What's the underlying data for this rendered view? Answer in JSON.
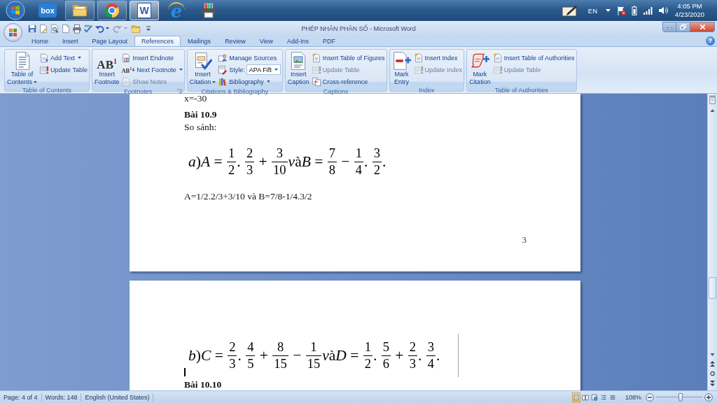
{
  "taskbar": {
    "apps": [
      {
        "kind": "box",
        "text": "box",
        "running": false,
        "selected": false
      },
      {
        "kind": "folder",
        "running": true,
        "selected": false
      },
      {
        "kind": "chrome",
        "running": true,
        "selected": false
      },
      {
        "kind": "word",
        "text": "W",
        "running": true,
        "selected": true
      },
      {
        "kind": "ie",
        "text": "e",
        "running": false,
        "selected": false
      },
      {
        "kind": "printer",
        "running": false,
        "selected": false
      }
    ],
    "tray": {
      "language": "EN",
      "time": "4:05 PM",
      "date": "4/23/2020"
    }
  },
  "window": {
    "title": "PHÉP NHÂN PHÂN SỐ - Microsoft Word",
    "help": "?"
  },
  "quick_access": [
    {
      "kind": "save",
      "dropdown": false,
      "disabled": false
    },
    {
      "kind": "edit",
      "dropdown": false,
      "disabled": false
    },
    {
      "kind": "preview",
      "dropdown": false,
      "disabled": false
    },
    {
      "kind": "new",
      "dropdown": false,
      "disabled": false
    },
    {
      "kind": "print",
      "dropdown": false,
      "disabled": false
    },
    {
      "kind": "spelling",
      "dropdown": false,
      "disabled": false
    },
    {
      "kind": "undo",
      "dropdown": true,
      "disabled": false
    },
    {
      "kind": "redo",
      "dropdown": true,
      "disabled": true
    },
    {
      "kind": "open",
      "dropdown": false,
      "disabled": false
    },
    {
      "kind": "customize",
      "dropdown": false,
      "disabled": false
    }
  ],
  "tabs": [
    {
      "label": "Home",
      "selected": false
    },
    {
      "label": "Insert",
      "selected": false
    },
    {
      "label": "Page Layout",
      "selected": false
    },
    {
      "label": "References",
      "selected": true
    },
    {
      "label": "Mailings",
      "selected": false
    },
    {
      "label": "Review",
      "selected": false
    },
    {
      "label": "View",
      "selected": false
    },
    {
      "label": "Add-Ins",
      "selected": false
    },
    {
      "label": "PDF",
      "selected": false
    }
  ],
  "ribbon": {
    "groups": [
      {
        "label": "Table of Contents",
        "launcher": false,
        "large": {
          "kind": "toc",
          "lines": [
            "Table of",
            "Contents"
          ],
          "dropdown": true
        },
        "small": [
          {
            "kind": "addtext",
            "label": "Add Text",
            "dropdown": true,
            "disabled": false
          },
          {
            "kind": "update",
            "label": "Update Table",
            "dropdown": false,
            "disabled": false
          }
        ]
      },
      {
        "label": "Footnotes",
        "launcher": true,
        "large": {
          "kind": "footnote",
          "glyph": "AB$^{1}$",
          "lines": [
            "Insert",
            "Footnote"
          ],
          "dropdown": false
        },
        "small": [
          {
            "kind": "endnote",
            "label": "Insert Endnote",
            "dropdown": false,
            "disabled": false
          },
          {
            "kind": "nextfootnote",
            "glyph": "AB$^{1}$",
            "label": "Next Footnote",
            "dropdown": true,
            "disabled": false
          },
          {
            "kind": "notes",
            "label": "Show Notes",
            "dropdown": false,
            "disabled": true
          }
        ]
      },
      {
        "label": "Citations & Bibliography",
        "launcher": false,
        "large": {
          "kind": "citation",
          "lines": [
            "Insert",
            "Citation"
          ],
          "dropdown": true
        },
        "small": [
          {
            "kind": "sources",
            "label": "Manage Sources",
            "dropdown": false,
            "disabled": false
          },
          {
            "kind": "combo",
            "label": "Style:",
            "value": "APA Fift",
            "dropdown": true,
            "disabled": false
          },
          {
            "kind": "bibliography",
            "label": "Bibliography",
            "dropdown": true,
            "disabled": false
          }
        ]
      },
      {
        "label": "Captions",
        "launcher": false,
        "large": {
          "kind": "caption",
          "lines": [
            "Insert",
            "Caption"
          ],
          "dropdown": false
        },
        "small": [
          {
            "kind": "figures",
            "label": "Insert Table of Figures",
            "dropdown": false,
            "disabled": false
          },
          {
            "kind": "update",
            "label": "Update Table",
            "dropdown": false,
            "disabled": true
          },
          {
            "kind": "crossref",
            "label": "Cross-reference",
            "dropdown": false,
            "disabled": false
          }
        ]
      },
      {
        "label": "Index",
        "launcher": false,
        "large": {
          "kind": "markentry",
          "lines": [
            "Mark",
            "Entry"
          ],
          "dropdown": false
        },
        "small": [
          {
            "kind": "index",
            "label": "Insert Index",
            "dropdown": false,
            "disabled": false
          },
          {
            "kind": "update",
            "label": "Update Index",
            "dropdown": false,
            "disabled": true
          }
        ]
      },
      {
        "label": "Table of Authorities",
        "launcher": false,
        "large": {
          "kind": "markcitation",
          "lines": [
            "Mark",
            "Citation"
          ],
          "dropdown": false
        },
        "small": [
          {
            "kind": "index",
            "label": "Insert Table of Authorities",
            "dropdown": false,
            "disabled": false
          },
          {
            "kind": "update",
            "label": "Update Table",
            "dropdown": false,
            "disabled": true
          }
        ]
      }
    ]
  },
  "document": {
    "pages": [
      {
        "blocks": [
          {
            "kind": "para",
            "text": "x=-30"
          },
          {
            "kind": "heading",
            "text": "Bài 10.9"
          },
          {
            "kind": "para",
            "text": "So sánh:"
          },
          {
            "kind": "math",
            "boundary_line": false,
            "tokens": [
              {
                "kind": "var",
                "text": "a"
              },
              {
                "kind": "text",
                "text": ")"
              },
              {
                "kind": "var",
                "text": "A"
              },
              {
                "kind": "text",
                "text": " = "
              },
              {
                "kind": "frac",
                "num": "1",
                "den": "2"
              },
              {
                "kind": "text",
                "text": ". "
              },
              {
                "kind": "frac",
                "num": "2",
                "den": "3"
              },
              {
                "kind": "text",
                "text": " + "
              },
              {
                "kind": "frac",
                "num": "3",
                "den": "10"
              },
              {
                "kind": "var",
                "text": "v"
              },
              {
                "kind": "text",
                "text": "à"
              },
              {
                "kind": "var",
                "text": "B"
              },
              {
                "kind": "text",
                "text": " = "
              },
              {
                "kind": "frac",
                "num": "7",
                "den": "8"
              },
              {
                "kind": "text",
                "text": " − "
              },
              {
                "kind": "frac",
                "num": "1",
                "den": "4"
              },
              {
                "kind": "text",
                "text": ". "
              },
              {
                "kind": "frac",
                "num": "3",
                "den": "2"
              },
              {
                "kind": "text",
                "text": "."
              }
            ]
          },
          {
            "kind": "para",
            "text": "A=1/2.2/3+3/10 và B=7/8-1/4.3/2"
          }
        ],
        "number": "3"
      },
      {
        "blocks": [
          {
            "kind": "math",
            "boundary_line": true,
            "tokens": [
              {
                "kind": "var",
                "text": "b"
              },
              {
                "kind": "text",
                "text": ")"
              },
              {
                "kind": "var",
                "text": "C"
              },
              {
                "kind": "text",
                "text": " = "
              },
              {
                "kind": "frac",
                "num": "2",
                "den": "3"
              },
              {
                "kind": "text",
                "text": ". "
              },
              {
                "kind": "frac",
                "num": "4",
                "den": "5"
              },
              {
                "kind": "text",
                "text": " + "
              },
              {
                "kind": "frac",
                "num": "8",
                "den": "15"
              },
              {
                "kind": "text",
                "text": " − "
              },
              {
                "kind": "frac",
                "num": "1",
                "den": "15"
              },
              {
                "kind": "var",
                "text": "v"
              },
              {
                "kind": "text",
                "text": "à"
              },
              {
                "kind": "var",
                "text": "D"
              },
              {
                "kind": "text",
                "text": " = "
              },
              {
                "kind": "frac",
                "num": "1",
                "den": "2"
              },
              {
                "kind": "text",
                "text": ". "
              },
              {
                "kind": "frac",
                "num": "5",
                "den": "6"
              },
              {
                "kind": "text",
                "text": " + "
              },
              {
                "kind": "frac",
                "num": "2",
                "den": "3"
              },
              {
                "kind": "text",
                "text": ". "
              },
              {
                "kind": "frac",
                "num": "3",
                "den": "4"
              },
              {
                "kind": "text",
                "text": "."
              }
            ]
          },
          {
            "kind": "cursor"
          },
          {
            "kind": "heading",
            "text": "Bài 10.10"
          }
        ]
      }
    ]
  },
  "status_bar": {
    "items": [
      "Page: 4 of 4",
      "Words: 148",
      "English (United States)"
    ],
    "views": [
      {
        "kind": "print-layout",
        "selected": true
      },
      {
        "kind": "reading",
        "selected": false
      },
      {
        "kind": "web",
        "selected": false
      },
      {
        "kind": "outline",
        "selected": false
      },
      {
        "kind": "draft",
        "selected": false
      }
    ],
    "zoom": {
      "label": "108%",
      "level": 0.53
    }
  }
}
